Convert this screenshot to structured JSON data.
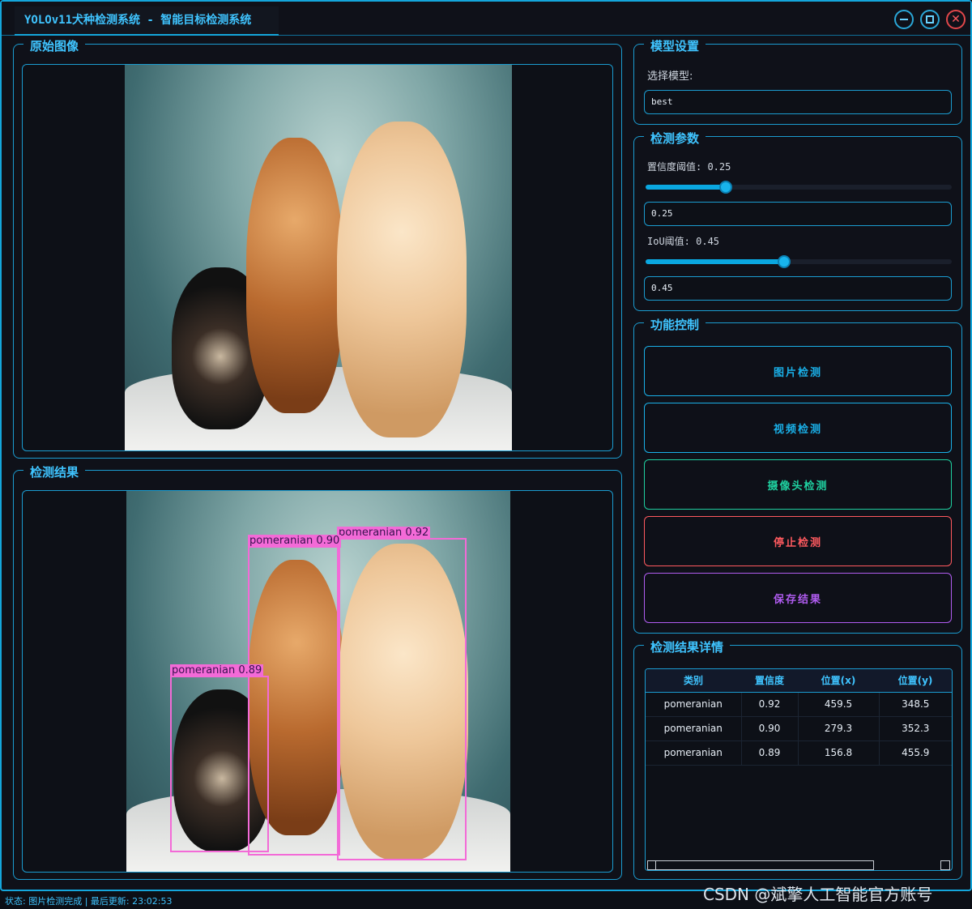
{
  "window": {
    "title": "YOLOv11犬种检测系统 - 智能目标检测系统"
  },
  "original_panel": {
    "title": "原始图像"
  },
  "result_panel": {
    "title": "检测结果"
  },
  "detections_overlay": [
    {
      "label": "pomeranian 0.92"
    },
    {
      "label": "pomeranian 0.90"
    },
    {
      "label": "pomeranian 0.89"
    }
  ],
  "model_settings": {
    "title": "模型设置",
    "select_label": "选择模型:",
    "selected_model": "best"
  },
  "detect_params": {
    "title": "检测参数",
    "confidence_label": "置信度阈值: 0.25",
    "confidence_value": "0.25",
    "confidence_level": 0.25,
    "iou_label": "IoU阈值: 0.45",
    "iou_value": "0.45",
    "iou_level": 0.45
  },
  "controls": {
    "title": "功能控制",
    "image_detect": "图片检测",
    "video_detect": "视频检测",
    "camera_detect": "摄像头检测",
    "stop_detect": "停止检测",
    "save_results": "保存结果"
  },
  "details": {
    "title": "检测结果详情",
    "columns": [
      "类别",
      "置信度",
      "位置(x)",
      "位置(y)"
    ],
    "rows": [
      [
        "pomeranian",
        "0.92",
        "459.5",
        "348.5"
      ],
      [
        "pomeranian",
        "0.90",
        "279.3",
        "352.3"
      ],
      [
        "pomeranian",
        "0.89",
        "156.8",
        "455.9"
      ]
    ]
  },
  "status_bar": {
    "text": "状态: 图片检测完成 | 最后更新: 23:02:53"
  },
  "watermark": "CSDN @斌擎人工智能官方账号",
  "colors": {
    "accent": "#14a6dc",
    "bbox": "#f36ad7",
    "image_btn": "#1ab0e8",
    "video_btn": "#1ab0e8",
    "camera_btn": "#1fd0a0",
    "stop_btn": "#ff5a5f",
    "save_btn": "#b05cf0"
  }
}
